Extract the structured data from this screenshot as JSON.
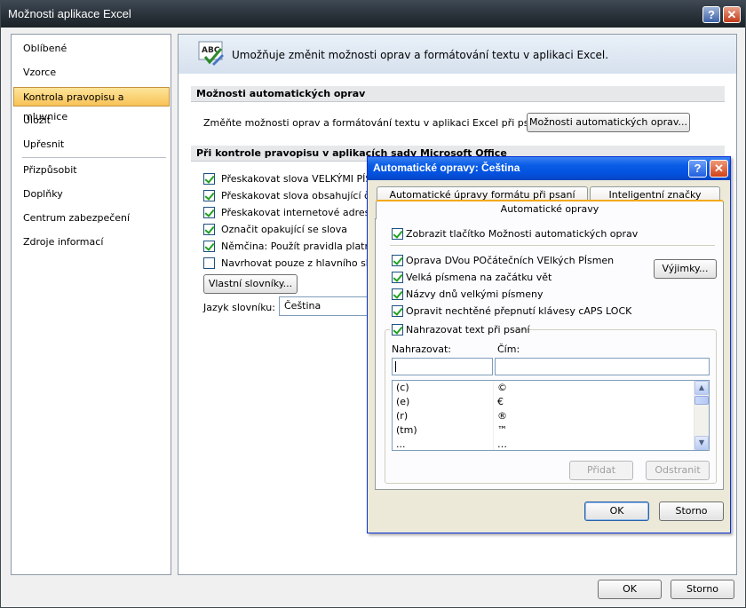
{
  "window": {
    "title": "Možnosti aplikace Excel",
    "help_glyph": "?",
    "close_glyph": "✕"
  },
  "nav": {
    "items": [
      {
        "label": "Oblíbené"
      },
      {
        "label": "Vzorce"
      },
      {
        "label": "Kontrola pravopisu a mluvnice",
        "selected": true
      },
      {
        "label": "Uložit"
      },
      {
        "label": "Upřesnit"
      },
      {
        "label": "Přizpůsobit"
      },
      {
        "label": "Doplňky"
      },
      {
        "label": "Centrum zabezpečení"
      },
      {
        "label": "Zdroje informací"
      }
    ]
  },
  "header": {
    "icon": "abc-proofing-icon",
    "text": "Umožňuje změnit možnosti oprav a formátování textu v aplikaci Excel."
  },
  "autocorrect_section": {
    "title": "Možnosti automatických oprav",
    "description": "Změňte možnosti oprav a formátování textu v aplikaci Excel při psaní:",
    "button_label": "Možnosti automatických oprav..."
  },
  "spelling_section": {
    "title": "Při kontrole pravopisu v aplikacích sady Microsoft Office",
    "options": [
      {
        "label": "Přeskakovat slova VELKÝMI PÍSMENY",
        "checked": true
      },
      {
        "label": "Přeskakovat slova obsahující čísl",
        "checked": true
      },
      {
        "label": "Přeskakovat internetové adresy a",
        "checked": true
      },
      {
        "label": "Označit opakující se slova",
        "checked": true
      },
      {
        "label": "Němčina: Použít pravidla platná",
        "checked": true
      },
      {
        "label": "Navrhovat pouze z hlavního slov",
        "checked": false
      }
    ],
    "custom_dict_button": "Vlastní slovníky...",
    "dict_lang_label": "Jazyk slovníku:",
    "dict_lang_value": "Čeština"
  },
  "main_buttons": {
    "ok": "OK",
    "cancel": "Storno"
  },
  "dialog": {
    "title": "Automatické opravy: Čeština",
    "help_glyph": "?",
    "close_glyph": "✕",
    "tabs": [
      {
        "label": "Automatické úpravy formátu při psaní"
      },
      {
        "label": "Inteligentní značky"
      },
      {
        "label": "Automatické opravy",
        "active": true
      }
    ],
    "show_buttons_option": {
      "label": "Zobrazit tlačítko Možnosti automatických oprav",
      "checked": true
    },
    "options": [
      {
        "label": "Oprava DVou POčátečních VElkých PÍsmen",
        "checked": true
      },
      {
        "label": "Velká písmena na začátku vět",
        "checked": true
      },
      {
        "label": "Názvy dnů velkými písmeny",
        "checked": true
      },
      {
        "label": "Opravit nechtěné přepnutí klávesy cAPS LOCK",
        "checked": true
      }
    ],
    "exceptions_button": "Výjimky...",
    "replace_option": {
      "label": "Nahrazovat text při psaní",
      "checked": true
    },
    "replace_label": "Nahrazovat:",
    "with_label": "Čím:",
    "replace_input_value": "",
    "with_input_value": "",
    "list_rows": [
      {
        "from": "(c)",
        "to": "©"
      },
      {
        "from": "(e)",
        "to": "€"
      },
      {
        "from": "(r)",
        "to": "®"
      },
      {
        "from": "(tm)",
        "to": "™"
      },
      {
        "from": "...",
        "to": "…"
      }
    ],
    "add_button": "Přidat",
    "delete_button": "Odstranit",
    "ok": "OK",
    "cancel": "Storno"
  }
}
